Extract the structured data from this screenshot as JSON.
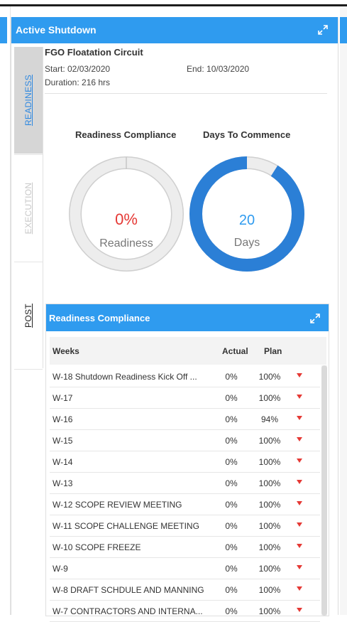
{
  "panel": {
    "title": "Active Shutdown"
  },
  "tabs": [
    {
      "label": "READINESS",
      "color": "#2f88e0"
    },
    {
      "label": "EXECUTION",
      "color": "#c8c8c8"
    },
    {
      "label": "POST",
      "color": "#222222"
    }
  ],
  "circuit": {
    "title": "FGO Floatation Circuit",
    "start": "Start: 02/03/2020",
    "end": "End: 10/03/2020",
    "duration": "Duration: 216 hrs"
  },
  "gauges": {
    "readiness": {
      "title": "Readiness Compliance",
      "value": "0%",
      "label": "Readiness",
      "percent": 0,
      "value_color": "#e53935"
    },
    "commence": {
      "title": "Days To Commence",
      "value": "20",
      "label": "Days",
      "fraction": 0.91,
      "value_color": "#2f9bef",
      "fill_color": "#2b7fd6"
    }
  },
  "compliance": {
    "title": "Readiness Compliance",
    "columns": [
      "Weeks",
      "Actual",
      "Plan"
    ],
    "rows": [
      {
        "week": "W-18 Shutdown Readiness Kick Off ...",
        "actual": "0%",
        "plan": "100%"
      },
      {
        "week": "W-17",
        "actual": "0%",
        "plan": "100%"
      },
      {
        "week": "W-16",
        "actual": "0%",
        "plan": "94%"
      },
      {
        "week": "W-15",
        "actual": "0%",
        "plan": "100%"
      },
      {
        "week": "W-14",
        "actual": "0%",
        "plan": "100%"
      },
      {
        "week": "W-13",
        "actual": "0%",
        "plan": "100%"
      },
      {
        "week": "W-12 SCOPE REVIEW MEETING",
        "actual": "0%",
        "plan": "100%"
      },
      {
        "week": "W-11 SCOPE CHALLENGE MEETING",
        "actual": "0%",
        "plan": "100%"
      },
      {
        "week": "W-10 SCOPE FREEZE",
        "actual": "0%",
        "plan": "100%"
      },
      {
        "week": "W-9",
        "actual": "0%",
        "plan": "100%"
      },
      {
        "week": "W-8 DRAFT SCHDULE AND MANNING",
        "actual": "0%",
        "plan": "100%"
      },
      {
        "week": "W-7 CONTRACTORS AND INTERNA...",
        "actual": "0%",
        "plan": "100%"
      }
    ],
    "status_icon": "down-arrow-icon",
    "status_color": "#e53935"
  },
  "icons": {
    "expand": "expand-icon",
    "accent": "#2f9bef"
  }
}
